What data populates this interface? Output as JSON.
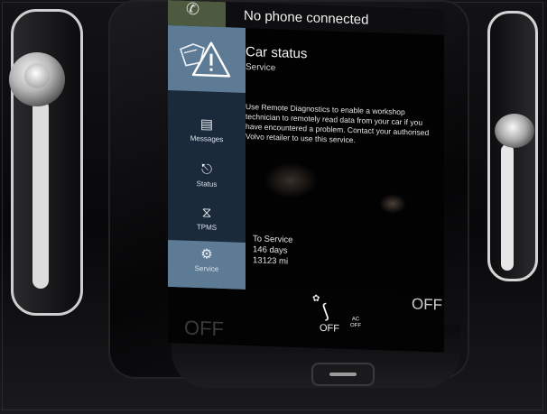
{
  "topbar": {
    "phone_icon": "phone-icon",
    "phone_status": "No phone connected"
  },
  "sidebar": {
    "hero_icon": "car-service-warning-icon",
    "items": [
      {
        "label": "Messages",
        "icon": "messages-icon"
      },
      {
        "label": "Status",
        "icon": "status-icon"
      },
      {
        "label": "TPMS",
        "icon": "tpms-icon"
      },
      {
        "label": "Service",
        "icon": "service-icon",
        "active": true
      }
    ]
  },
  "content": {
    "title": "Car status",
    "subtitle": "Service",
    "body": "Use Remote Diagnostics to enable a workshop technician to remotely read data from your car if you have encountered a problem. Contact your authorised Volvo retailer to use this service.",
    "to_service_label": "To Service",
    "days": "146 days",
    "distance": "13123 mi"
  },
  "climate": {
    "left_off": "OFF",
    "center_off": "OFF",
    "ac_label_top": "AC",
    "ac_label_bottom": "OFF",
    "right_off": "OFF",
    "seat_heat_icon": "seat-heat-icon"
  },
  "colors": {
    "sidebar_bg": "#1b2a3a",
    "sidebar_accent": "#5e7b96",
    "screen_bg": "#050506",
    "text": "#f2f2f2"
  }
}
